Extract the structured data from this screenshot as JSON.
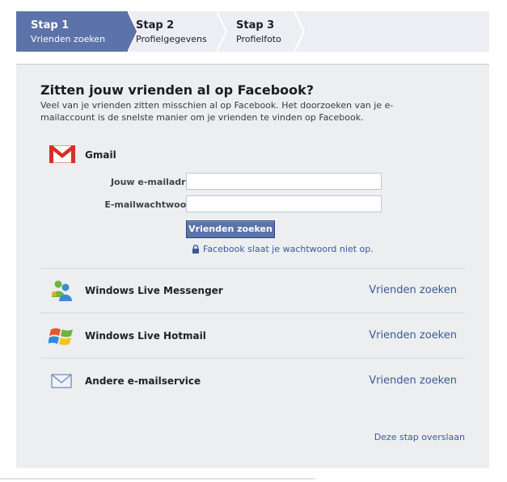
{
  "steps": [
    {
      "number": "Stap 1",
      "label": "Vrienden zoeken",
      "active": true
    },
    {
      "number": "Stap 2",
      "label": "Profielgegevens",
      "active": false
    },
    {
      "number": "Stap 3",
      "label": "Profielfoto",
      "active": false
    }
  ],
  "main": {
    "title": "Zitten jouw vrienden al op Facebook?",
    "intro": "Veel van je vrienden zitten misschien al op Facebook. Het doorzoeken van je e-mailaccount is de snelste manier om je vrienden te vinden op Facebook."
  },
  "gmail": {
    "label": "Gmail",
    "email_label": "Jouw e-mailadres:",
    "email_value": "",
    "password_label": "E-mailwachtwoord:",
    "password_value": "",
    "button_label": "Vrienden zoeken",
    "privacy_note": "Facebook slaat je wachtwoord niet op."
  },
  "services": [
    {
      "name": "Windows Live Messenger",
      "link": "Vrienden zoeken",
      "icon": "messenger-icon"
    },
    {
      "name": "Windows Live Hotmail",
      "link": "Vrienden zoeken",
      "icon": "windows-icon"
    },
    {
      "name": "Andere e-mailservice",
      "link": "Vrienden zoeken",
      "icon": "envelope-icon"
    }
  ],
  "skip_link": "Deze stap overslaan",
  "colors": {
    "brand_blue": "#3b5998",
    "active_step": "#5b73a9",
    "panel_bg": "#eceeef",
    "gmail_red": "#d93025"
  }
}
